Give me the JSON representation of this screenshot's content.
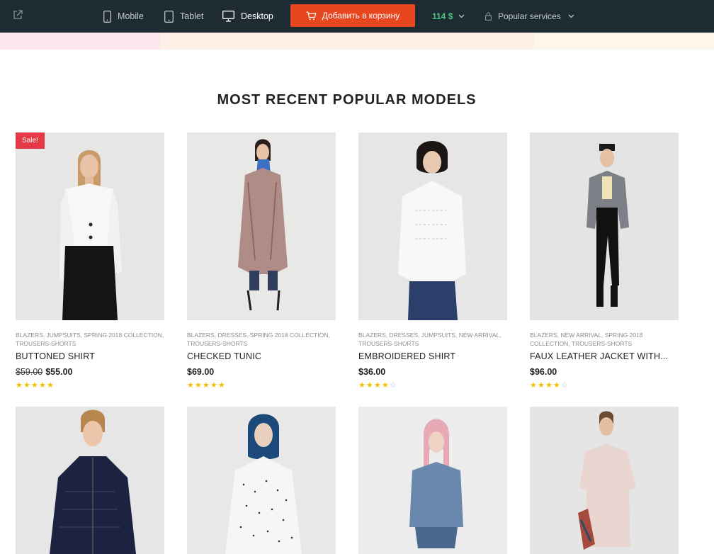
{
  "topbar": {
    "devices": [
      {
        "label": "Mobile",
        "icon": "phone-icon",
        "active": false
      },
      {
        "label": "Tablet",
        "icon": "tablet-icon",
        "active": false
      },
      {
        "label": "Desktop",
        "icon": "monitor-icon",
        "active": true
      }
    ],
    "cart_label": "Добавить в корзину",
    "price_label": "114 $",
    "services_label": "Popular services",
    "colors": {
      "bg": "#1f2b33",
      "accent": "#e8461f",
      "price": "#49c47b"
    }
  },
  "section": {
    "title": "MOST RECENT POPULAR MODELS"
  },
  "products": [
    {
      "badge": "Sale!",
      "categories": "BLAZERS, JUMPSUITS, SPRING 2018 COLLECTION, TROUSERS-SHORTS",
      "name": "BUTTONED SHIRT",
      "old_price": "$59.00",
      "price": "$55.00",
      "rating": 5,
      "image": "woman-white-shirt"
    },
    {
      "badge": "",
      "categories": "BLAZERS, DRESSES, SPRING 2018 COLLECTION, TROUSERS-SHORTS",
      "name": "CHECKED TUNIC",
      "old_price": "",
      "price": "$69.00",
      "rating": 5,
      "image": "woman-checked-tunic"
    },
    {
      "badge": "",
      "categories": "BLAZERS, DRESSES, JUMPSUITS, NEW ARRIVAL, TROUSERS-SHORTS",
      "name": "EMBROIDERED SHIRT",
      "old_price": "",
      "price": "$36.00",
      "rating": 4,
      "image": "woman-embroidered-shirt"
    },
    {
      "badge": "",
      "categories": "BLAZERS, NEW ARRIVAL, SPRING 2018 COLLECTION, TROUSERS-SHORTS",
      "name": "FAUX LEATHER JACKET WITH...",
      "old_price": "",
      "price": "$96.00",
      "rating": 4,
      "image": "woman-leather-jacket"
    },
    {
      "image": "woman-puffer-jacket"
    },
    {
      "image": "woman-polka-dress"
    },
    {
      "image": "woman-denim-jacket"
    },
    {
      "image": "woman-pink-dress"
    }
  ]
}
